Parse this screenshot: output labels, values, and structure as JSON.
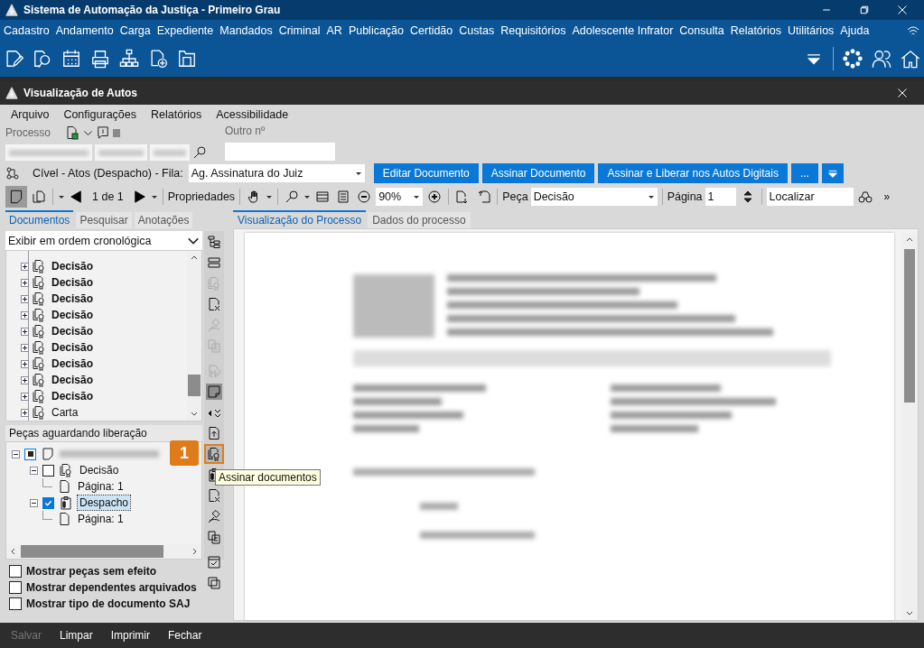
{
  "window": {
    "title": "Sistema de Automação da Justiça - Primeiro Grau"
  },
  "main_menu": [
    "Cadastro",
    "Andamento",
    "Carga",
    "Expediente",
    "Mandados",
    "Criminal",
    "AR",
    "Publicação",
    "Certidão",
    "Custas",
    "Requisitórios",
    "Adolescente Infrator",
    "Consulta",
    "Relatórios",
    "Utilitários",
    "Ajuda"
  ],
  "inner_window": {
    "title": "Visualização de Autos"
  },
  "menu": [
    "Arquivo",
    "Configurações",
    "Relatórios",
    "Acessibilidade"
  ],
  "process": {
    "label": "Processo",
    "other_label": "Outro nº"
  },
  "queue": {
    "label": "Cível - Atos (Despacho) - Fila:",
    "value": "Ag. Assinatura do Juiz"
  },
  "actions": [
    "Editar Documento",
    "Assinar Documento",
    "Assinar e Liberar nos Autos Digitais",
    "..."
  ],
  "viewer_toolbar": {
    "page_count": "1 de 1",
    "properties": "Propriedades",
    "zoom": "90%",
    "piece_label": "Peça",
    "piece": "Decisão",
    "page_label": "Página",
    "page": "1",
    "search_placeholder": "Localizar",
    "more": "»"
  },
  "left_tabs": [
    {
      "label": "Documentos",
      "selected": true
    },
    {
      "label": "Pesquisar",
      "selected": false
    },
    {
      "label": "Anotações",
      "selected": false
    }
  ],
  "order": "Exibir em ordem cronológica",
  "documents": [
    {
      "label": "Decisão",
      "bold": true
    },
    {
      "label": "Decisão",
      "bold": true
    },
    {
      "label": "Decisão",
      "bold": true
    },
    {
      "label": "Decisão",
      "bold": true
    },
    {
      "label": "Decisão",
      "bold": true
    },
    {
      "label": "Decisão",
      "bold": true
    },
    {
      "label": "Decisão",
      "bold": true
    },
    {
      "label": "Decisão",
      "bold": true
    },
    {
      "label": "Decisão",
      "bold": true
    },
    {
      "label": "Carta",
      "bold": false
    }
  ],
  "pending": {
    "title": "Peças aguardando liberação",
    "root": {
      "partial": true
    },
    "items": [
      {
        "label": "Decisão",
        "checked": false,
        "selected": false,
        "children": [
          {
            "label": "Página: 1"
          }
        ]
      },
      {
        "label": "Despacho",
        "checked": true,
        "selected": true,
        "children": [
          {
            "label": "Página: 1"
          }
        ]
      }
    ]
  },
  "options": [
    {
      "label": "Mostrar peças sem efeito",
      "checked": false
    },
    {
      "label": "Mostrar dependentes arquivados",
      "checked": false
    },
    {
      "label": "Mostrar tipo de documento SAJ",
      "checked": false
    }
  ],
  "side_tool_groups": [
    [
      {
        "kind": "tree",
        "disabled": false,
        "selected": false,
        "callout": false
      },
      {
        "kind": "stack",
        "disabled": false,
        "selected": false,
        "callout": false
      },
      {
        "kind": "seal",
        "disabled": true,
        "selected": false,
        "callout": false
      },
      {
        "kind": "delete",
        "disabled": false,
        "selected": false,
        "callout": false
      },
      {
        "kind": "gavel",
        "disabled": true,
        "selected": false,
        "callout": false
      },
      {
        "kind": "copy",
        "disabled": true,
        "selected": false,
        "callout": false
      }
    ],
    [
      {
        "kind": "edit",
        "disabled": true,
        "selected": false,
        "callout": false
      },
      {
        "kind": "note",
        "disabled": false,
        "selected": true,
        "callout": false
      },
      {
        "kind": "arrows",
        "disabled": false,
        "selected": false,
        "callout": false
      },
      {
        "kind": "export",
        "disabled": false,
        "selected": false,
        "callout": false
      },
      {
        "kind": "seal",
        "disabled": false,
        "selected": false,
        "callout": true
      },
      {
        "kind": "clipboard",
        "disabled": false,
        "selected": false,
        "callout": false
      },
      {
        "kind": "delete",
        "disabled": false,
        "selected": false,
        "callout": false
      },
      {
        "kind": "gavel",
        "disabled": false,
        "selected": false,
        "callout": false
      },
      {
        "kind": "copy",
        "disabled": false,
        "selected": false,
        "callout": false
      }
    ],
    [
      {
        "kind": "check",
        "disabled": false,
        "selected": false,
        "callout": false
      },
      {
        "kind": "windows",
        "disabled": false,
        "selected": false,
        "callout": false
      }
    ]
  ],
  "callout": {
    "number": "1",
    "tooltip": "Assinar documentos"
  },
  "viewer_tabs": [
    {
      "label": "Visualização do Processo",
      "selected": true
    },
    {
      "label": "Dados do processo",
      "selected": false
    }
  ],
  "footer": [
    {
      "label": "Salvar",
      "disabled": true
    },
    {
      "label": "Limpar",
      "disabled": false
    },
    {
      "label": "Imprimir",
      "disabled": false
    },
    {
      "label": "Fechar",
      "disabled": false
    }
  ]
}
